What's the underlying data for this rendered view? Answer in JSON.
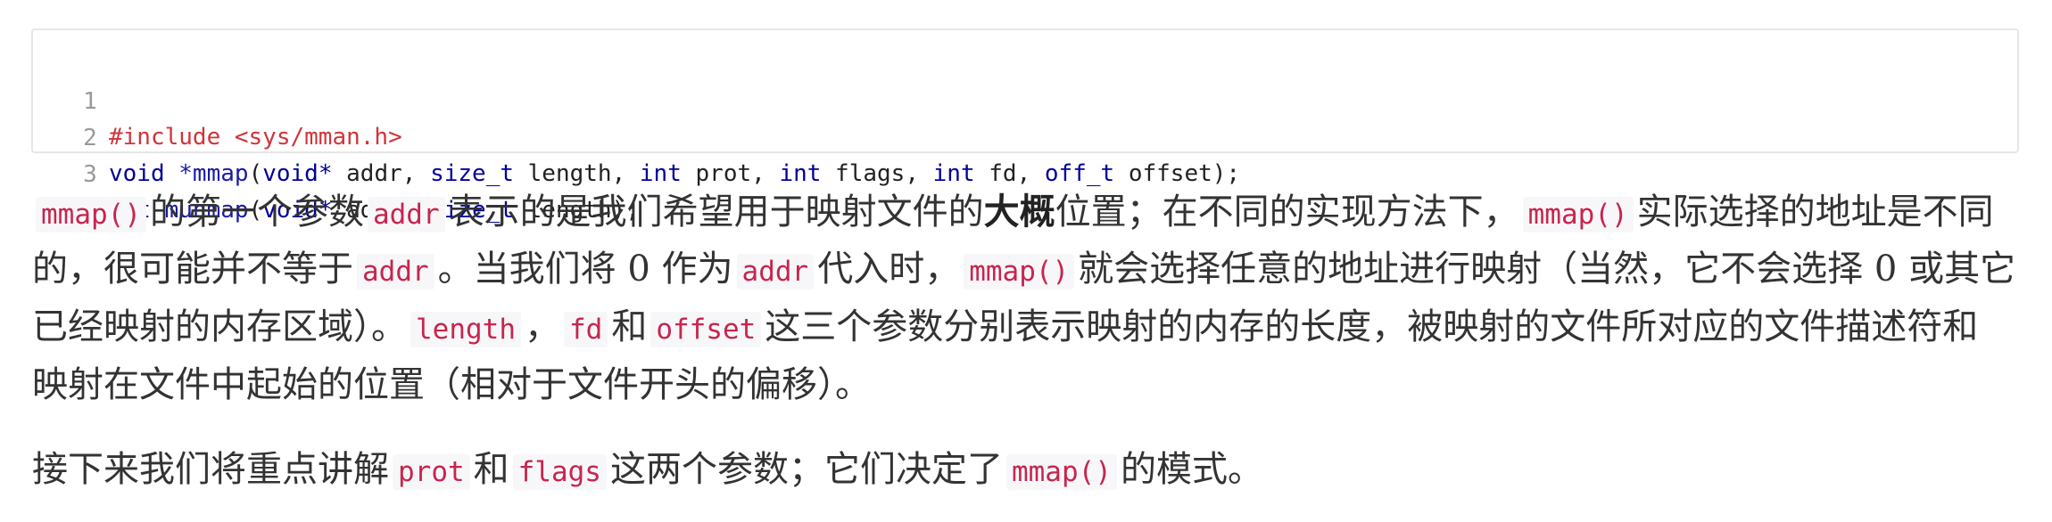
{
  "code_block": {
    "lines": [
      {
        "num": "1",
        "tokens": [
          {
            "t": "#include <sys/mman.h>",
            "k": "pre"
          }
        ]
      },
      {
        "num": "2",
        "tokens": [
          {
            "t": "void",
            "k": "kw"
          },
          {
            "t": " ",
            "k": "plain"
          },
          {
            "t": "*mmap",
            "k": "fn"
          },
          {
            "t": "(",
            "k": "plain"
          },
          {
            "t": "void*",
            "k": "kw"
          },
          {
            "t": " addr, ",
            "k": "plain"
          },
          {
            "t": "size_t",
            "k": "type"
          },
          {
            "t": " length, ",
            "k": "plain"
          },
          {
            "t": "int",
            "k": "kw"
          },
          {
            "t": " prot, ",
            "k": "plain"
          },
          {
            "t": "int",
            "k": "kw"
          },
          {
            "t": " flags, ",
            "k": "plain"
          },
          {
            "t": "int",
            "k": "kw"
          },
          {
            "t": " fd, ",
            "k": "plain"
          },
          {
            "t": "off_t",
            "k": "type"
          },
          {
            "t": " offset);",
            "k": "plain"
          }
        ]
      },
      {
        "num": "3",
        "tokens": [
          {
            "t": "int",
            "k": "kw"
          },
          {
            "t": " ",
            "k": "plain"
          },
          {
            "t": "munmap",
            "k": "fn"
          },
          {
            "t": "(",
            "k": "plain"
          },
          {
            "t": "void*",
            "k": "kw"
          },
          {
            "t": " addr, ",
            "k": "plain"
          },
          {
            "t": "size_t",
            "k": "type"
          },
          {
            "t": " length);",
            "k": "plain"
          }
        ]
      }
    ]
  },
  "paragraph1": {
    "line1": [
      {
        "c": "mmap()"
      },
      {
        "t": "的第一个参数"
      },
      {
        "c": "addr"
      },
      {
        "t": "表示的是我们希望用于映射文件的"
      },
      {
        "b": "大概"
      },
      {
        "t": "位置；在不同的实现方法下，"
      },
      {
        "c": "mmap()"
      },
      {
        "t": "实际选择的地址是不同"
      }
    ],
    "line2": [
      {
        "t": "的，很可能并不等于"
      },
      {
        "c": "addr"
      },
      {
        "t": "。当我们将 0 作为"
      },
      {
        "c": "addr"
      },
      {
        "t": "代入时，"
      },
      {
        "c": "mmap()"
      },
      {
        "t": "就会选择任意的地址进行映射（当然，它不会选择 0 或其它"
      }
    ],
    "line3": [
      {
        "t": "已经映射的内存区域）。"
      },
      {
        "c": "length"
      },
      {
        "t": "，"
      },
      {
        "c": "fd"
      },
      {
        "t": "和"
      },
      {
        "c": "offset"
      },
      {
        "t": "这三个参数分别表示映射的内存的长度，被映射的文件所对应的文件描述符和"
      }
    ],
    "line4": [
      {
        "t": "映射在文件中起始的位置（相对于文件开头的偏移）。"
      }
    ]
  },
  "paragraph2": {
    "line1": [
      {
        "t": "接下来我们将重点讲解"
      },
      {
        "c": "prot"
      },
      {
        "t": "和"
      },
      {
        "c": "flags"
      },
      {
        "t": "这两个参数；它们决定了"
      },
      {
        "c": "mmap()"
      },
      {
        "t": "的模式。"
      }
    ]
  }
}
